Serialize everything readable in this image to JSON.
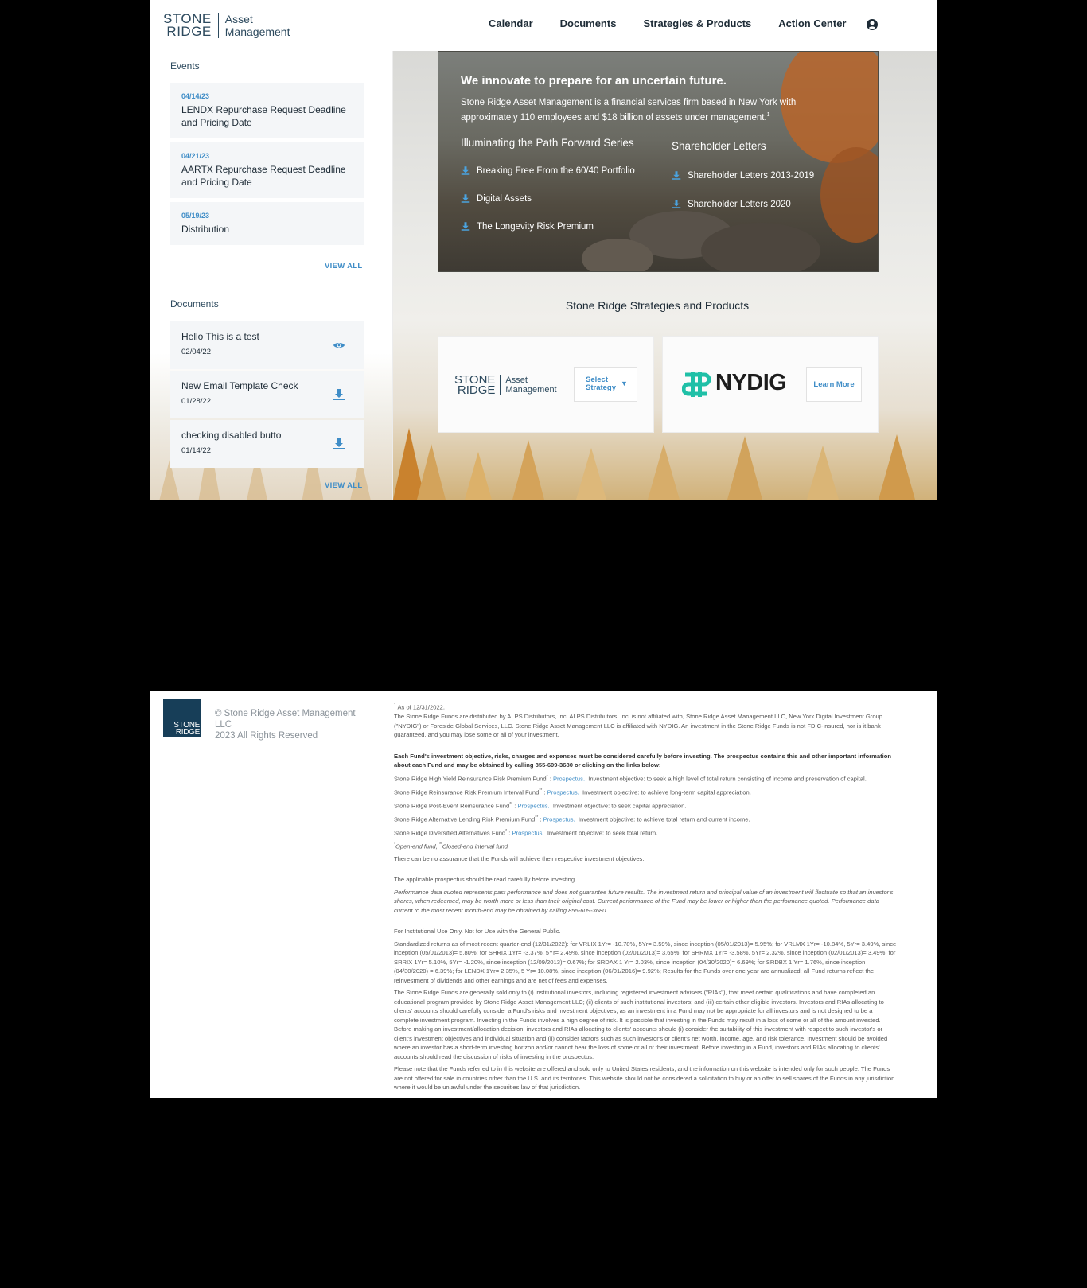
{
  "header": {
    "logo": {
      "line1": "STONE",
      "line2": "RIDGE",
      "line3": "Asset",
      "line4": "Management"
    },
    "nav": [
      "Calendar",
      "Documents",
      "Strategies & Products",
      "Action Center"
    ],
    "user_icon": "user-circle-icon"
  },
  "sidebar": {
    "events_title": "Events",
    "events": [
      {
        "date": "04/14/23",
        "title": "LENDX Repurchase Request Deadline and Pricing Date"
      },
      {
        "date": "04/21/23",
        "title": "AARTX Repurchase Request Deadline and Pricing Date"
      },
      {
        "date": "05/19/23",
        "title": "Distribution"
      }
    ],
    "events_view_all": "VIEW ALL",
    "documents_title": "Documents",
    "documents": [
      {
        "title": "Hello This is a test",
        "date": "02/04/22",
        "icon": "eye-icon"
      },
      {
        "title": "New Email Template Check",
        "date": "01/28/22",
        "icon": "download-icon"
      },
      {
        "title": "checking disabled butto",
        "date": "01/14/22",
        "icon": "download-icon"
      }
    ],
    "documents_view_all": "VIEW ALL"
  },
  "hero": {
    "heading": "We innovate to prepare for an uncertain future.",
    "text": "Stone Ridge Asset Management is a financial services firm based in New York with approximately 110 employees and $18 billion of assets under management.",
    "footnote": "1",
    "series_title": "Illuminating the Path Forward Series",
    "series_links": [
      "Breaking Free From the 60/40 Portfolio",
      "Digital Assets",
      "The Longevity Risk Premium"
    ],
    "letters_title": "Shareholder Letters",
    "letters_links": [
      "Shareholder Letters 2013-2019",
      "Shareholder Letters 2020"
    ]
  },
  "products": {
    "title": "Stone Ridge Strategies and Products",
    "select_label_1": "Select",
    "select_label_2": "Strategy",
    "nydig": "NYDIG",
    "learn_more": "Learn More"
  },
  "footer": {
    "logo_line1": "STONE",
    "logo_line2": "RIDGE",
    "copyright_1": "© Stone Ridge Asset Management LLC",
    "copyright_2": "2023 All Rights Reserved",
    "fn_mark": "1",
    "as_of": "As of 12/31/2022.",
    "distributed": "The Stone Ridge Funds are distributed by ALPS Distributors, Inc. ALPS Distributors, Inc. is not affiliated with, Stone Ridge Asset Management LLC, New York Digital Investment Group (\"NYDIG\") or Foreside Global Services, LLC. Stone Ridge Asset Management LLC is affiliated with NYDIG. An investment in the Stone Ridge Funds is not FDIC-insured, nor is it bank guaranteed, and you may lose some or all of your investment.",
    "objective_bold": "Each Fund's investment objective, risks, charges and expenses must be considered carefully before investing. The prospectus contains this and other important information about each Fund and may be obtained by calling 855-609-3680 or clicking on the links below:",
    "funds": [
      {
        "name": "Stone Ridge High Yield Reinsurance Risk Premium Fund",
        "mark": "*",
        "objective": "Investment objective: to seek a high level of total return consisting of income and preservation of capital."
      },
      {
        "name": "Stone Ridge Reinsurance Risk Premium Interval Fund",
        "mark": "**",
        "objective": "Investment objective: to achieve long-term capital appreciation."
      },
      {
        "name": "Stone Ridge Post-Event Reinsurance Fund",
        "mark": "**",
        "objective": "Investment objective: to seek capital appreciation."
      },
      {
        "name": "Stone Ridge Alternative Lending Risk Premium Fund",
        "mark": "**",
        "objective": "Investment objective: to achieve total return and current income."
      },
      {
        "name": "Stone Ridge Diversified Alternatives Fund",
        "mark": "*",
        "objective": "Investment objective: to seek total return."
      }
    ],
    "colon": ":",
    "prospectus_label": "Prospectus.",
    "fund_type_mark_1": "*",
    "fund_type_text_1": "Open-end fund, ",
    "fund_type_mark_2": "**",
    "fund_type_text_2": "Closed-end interval fund",
    "no_assurance": "There can be no assurance that the Funds will achieve their respective investment objectives.",
    "read_prospectus": "The applicable prospectus should be read carefully before investing.",
    "performance": "Performance data quoted represents past performance and does not guarantee future results. The investment return and principal value of an investment will fluctuate so that an investor's shares, when redeemed, may be worth more or less than their original cost. Current performance of the Fund may be lower or higher than the performance quoted. Performance data current to the most recent month-end may be obtained by calling 855-609-3680.",
    "institutional": "For Institutional Use Only. Not for Use with the General Public.",
    "standardized": "Standardized returns as of most recent quarter-end (12/31/2022): for VRLIX 1Yr= -10.78%, 5Yr= 3.59%, since inception (05/01/2013)= 5.95%; for VRLMX 1Yr= -10.84%, 5Yr= 3.49%, since inception (05/01/2013)= 5.80%; for SHRIX 1Yr= -3.37%, 5Yr= 2.49%, since inception (02/01/2013)= 3.65%; for SHRMX 1Yr= -3.58%, 5Yr= 2.32%, since inception (02/01/2013)= 3.49%; for SRRIX 1Yr= 5.10%, 5Yr= -1.20%, since inception (12/09/2013)= 0.67%; for SRDAX 1 Yr= 2.03%, since inception (04/30/2020)= 6.69%; for SRDBX 1 Yr= 1.76%, since inception (04/30/2020) = 6.39%; for LENDX 1Yr= 2.35%, 5 Yr= 10.08%, since inception (06/01/2016)= 9.92%; Results for the Funds over one year are annualized; all Fund returns reflect the reinvestment of dividends and other earnings and are net of fees and expenses.",
    "sold_only": "The Stone Ridge Funds are generally sold only to (i) institutional investors, including registered investment advisers (\"RIAs\"), that meet certain qualifications and have completed an educational program provided by Stone Ridge Asset Management LLC; (ii) clients of such institutional investors; and (iii) certain other eligible investors. Investors and RIAs allocating to clients' accounts should carefully consider a Fund's risks and investment objectives, as an investment in a Fund may not be appropriate for all investors and is not designed to be a complete investment program. Investing in the Funds involves a high degree of risk. It is possible that investing in the Funds may result in a loss of some or all of the amount invested. Before making an investment/allocation decision, investors and RIAs allocating to clients' accounts should (i) consider the suitability of this investment with respect to such investor's or client's investment objectives and individual situation and (ii) consider factors such as such investor's or client's net worth, income, age, and risk tolerance. Investment should be avoided where an investor has a short-term investing horizon and/or cannot bear the loss of some or all of their investment. Before investing in a Fund, investors and RIAs allocating to clients' accounts should read the discussion of risks of investing in the prospectus.",
    "us_residents": "Please note that the Funds referred to in this website are offered and sold only to United States residents, and the information on this website is intended only for such people. The Funds are not offered for sale in countries other than the U.S. and its territories. This website should not be considered a solicitation to buy or an offer to sell shares of the Funds in any jurisdiction where it would be unlawful under the securities law of that jurisdiction."
  }
}
